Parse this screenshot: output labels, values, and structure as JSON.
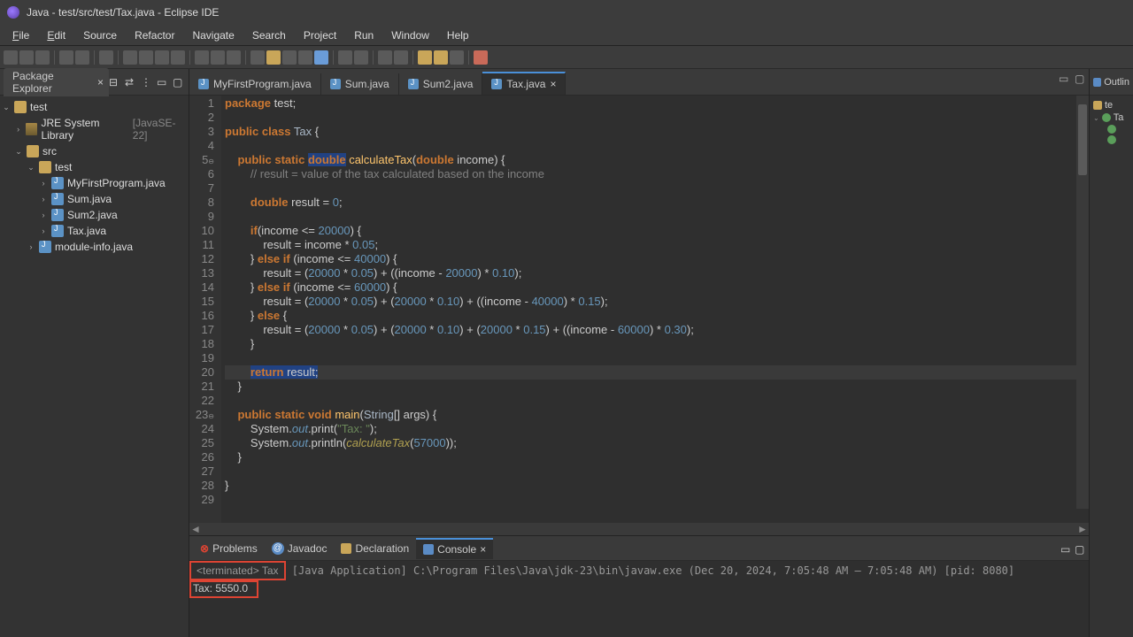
{
  "window": {
    "title": "Java - test/src/test/Tax.java - Eclipse IDE"
  },
  "menu": {
    "file": "File",
    "edit": "Edit",
    "source": "Source",
    "refactor": "Refactor",
    "navigate": "Navigate",
    "search": "Search",
    "project": "Project",
    "run": "Run",
    "window": "Window",
    "help": "Help"
  },
  "explorer": {
    "title": "Package Explorer",
    "project": "test",
    "jre": "JRE System Library",
    "jre_version": "[JavaSE-22]",
    "src": "src",
    "pkg": "test",
    "files": [
      "MyFirstProgram.java",
      "Sum.java",
      "Sum2.java",
      "Tax.java"
    ],
    "module": "module-info.java"
  },
  "tabs": {
    "t1": "MyFirstProgram.java",
    "t2": "Sum.java",
    "t3": "Sum2.java",
    "t4": "Tax.java"
  },
  "code": {
    "l1": "package test;",
    "l3a": "public class ",
    "l3b": "Tax",
    "l3c": " {",
    "l5a": "    public static ",
    "l5b": "double",
    "l5c": " calculateTax",
    "l5d": "(double income) {",
    "l6": "        // result = value of the tax calculated based on the income",
    "l8": "        double result = 0;",
    "l10": "        if(income <= 20000) {",
    "l11": "            result = income * 0.05;",
    "l12": "        } else if (income <= 40000) {",
    "l13": "            result = (20000 * 0.05) + ((income - 20000) * 0.10);",
    "l14": "        } else if (income <= 60000) {",
    "l15": "            result = (20000 * 0.05) + (20000 * 0.10) + ((income - 40000) * 0.15);",
    "l16": "        } else {",
    "l17": "            result = (20000 * 0.05) + (20000 * 0.10) + (20000 * 0.15) + ((income - 60000) * 0.30);",
    "l18": "        }",
    "l20a": "        ",
    "l20b": "return result;",
    "l21": "    }",
    "l23": "    public static void main(String[] args) {",
    "l24": "        System.out.print(\"Tax: \");",
    "l25": "        System.out.println(calculateTax(57000));",
    "l26": "    }",
    "l28": "}"
  },
  "bottom": {
    "problems": "Problems",
    "javadoc": "Javadoc",
    "declaration": "Declaration",
    "console": "Console",
    "meta_prefix": "<terminated> Tax",
    "meta_rest": " [Java Application] C:\\Program Files\\Java\\jdk-23\\bin\\javaw.exe  (Dec 20, 2024, 7:05:48 AM – 7:05:48 AM) [pid: 8080]",
    "output": "Tax: 5550.0"
  },
  "outline": {
    "title": "Outlin",
    "pkg": "te",
    "cls": "Ta"
  }
}
